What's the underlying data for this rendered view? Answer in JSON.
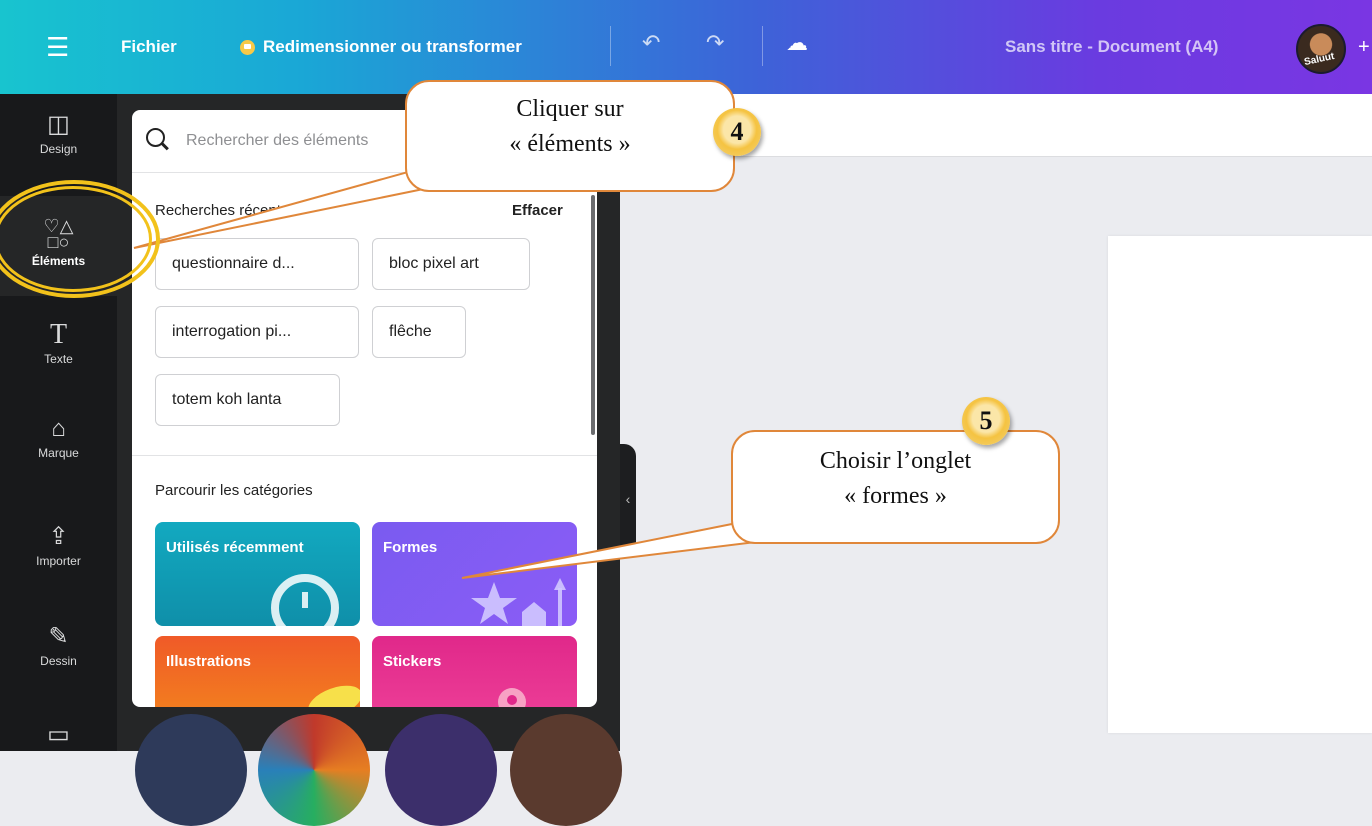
{
  "topbar": {
    "file_label": "Fichier",
    "resize_label": "Redimensionner ou transformer",
    "doc_title": "Sans titre - Document (A4)",
    "avatar_text": "Saluut"
  },
  "rail": {
    "items": [
      {
        "label": "Design",
        "icon": "layout-icon"
      },
      {
        "label": "Éléments",
        "icon": "shapes-icon"
      },
      {
        "label": "Texte",
        "icon": "text-icon"
      },
      {
        "label": "Marque",
        "icon": "brand-icon"
      },
      {
        "label": "Importer",
        "icon": "cloud-upload-icon"
      },
      {
        "label": "Dessin",
        "icon": "draw-icon"
      }
    ]
  },
  "panel": {
    "search_placeholder": "Rechercher des éléments",
    "recent_heading": "Recherches récentes",
    "clear_label": "Effacer",
    "recent_searches": [
      "questionnaire d...",
      "bloc pixel art",
      "interrogation pi...",
      "flêche",
      "totem koh lanta"
    ],
    "browse_heading": "Parcourir les catégories",
    "categories": [
      "Utilisés récemment",
      "Formes",
      "Illustrations",
      "Stickers"
    ]
  },
  "annotations": {
    "step4": {
      "number": "4",
      "text_line1": "Cliquer sur",
      "text_line2": "« éléments »"
    },
    "step5": {
      "number": "5",
      "text_line1": "Choisir l’onglet",
      "text_line2": "« formes »"
    }
  },
  "colors": {
    "accent_orange": "#e0873a",
    "highlight_yellow": "#f2c21b",
    "rail_bg": "#18191b"
  }
}
